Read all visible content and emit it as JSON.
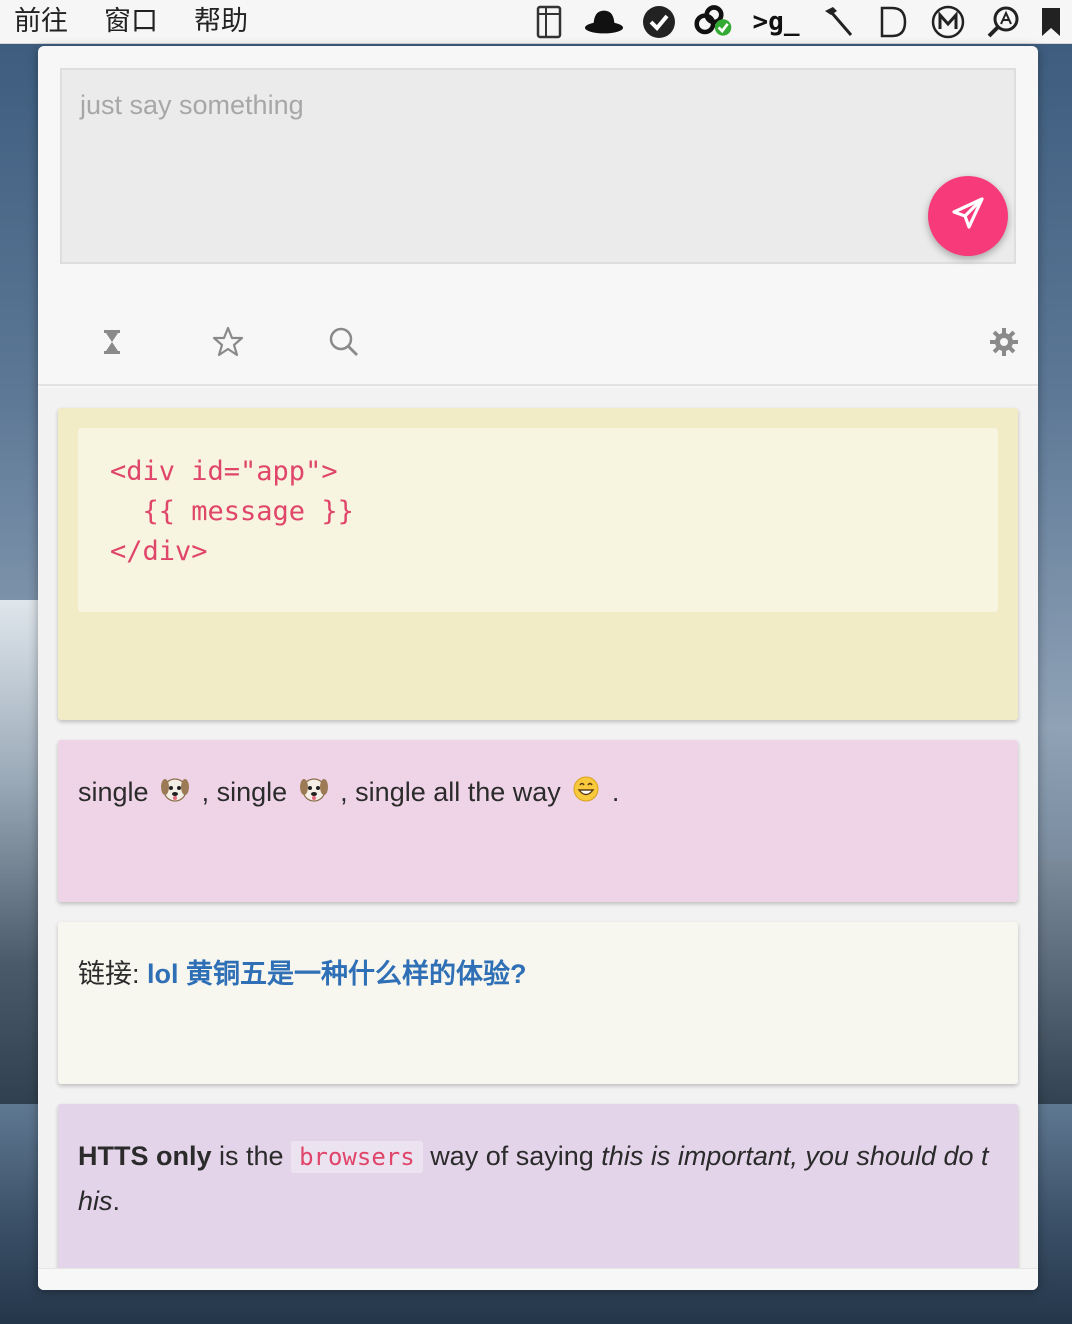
{
  "menubar": {
    "items": [
      "前往",
      "窗口",
      "帮助"
    ],
    "tray_icons": [
      "sidebar-icon",
      "bowler-hat-icon",
      "checkmark-circle-icon",
      "cluster-check-icon",
      "terminal-g-icon",
      "hammer-icon",
      "d-letter-icon",
      "m-circle-icon",
      "search-a-icon",
      "bookmark-icon"
    ],
    "terminal_glyph": ">g_"
  },
  "composer": {
    "placeholder": "just say something",
    "value": ""
  },
  "toolbar": {
    "icons": [
      "hourglass-icon",
      "star-icon",
      "search-icon",
      "gear-icon"
    ]
  },
  "feed": {
    "code_card": {
      "code": "<div id=\"app\">\n  {{ message }}\n</div>"
    },
    "single_card": {
      "part1": "single",
      "sep1": ", single",
      "sep2": ", single all the way",
      "end": "."
    },
    "link_card": {
      "label": "链接:",
      "link_text": "lol 黄铜五是一种什么样的体验?"
    },
    "https_card": {
      "bold": "HTTS only",
      "text1": "is the",
      "code": "browsers",
      "text2": "way of saying",
      "italic": "this is important, you should do this",
      "end": "."
    }
  },
  "colors": {
    "accent": "#f73b7a",
    "link": "#2e6fb5",
    "code": "#e0456a",
    "card_yellow": "#f1ecc6",
    "card_pink": "#efd4e8",
    "card_white": "#f7f6ef",
    "card_purple": "#e3d4ea"
  }
}
